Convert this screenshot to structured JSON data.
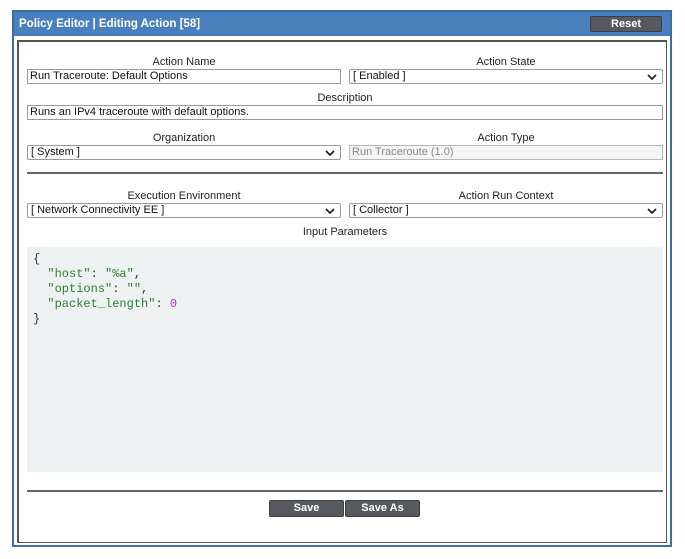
{
  "titlebar": {
    "title": "Policy Editor | Editing Action [58]",
    "reset_label": "Reset"
  },
  "form": {
    "action_name": {
      "label": "Action Name",
      "value": "Run Traceroute: Default Options"
    },
    "action_state": {
      "label": "Action State",
      "value": "[ Enabled ]"
    },
    "description": {
      "label": "Description",
      "value": "Runs an IPv4 traceroute with default options."
    },
    "organization": {
      "label": "Organization",
      "value": "[ System ]"
    },
    "action_type": {
      "label": "Action Type",
      "value": "Run Traceroute (1.0)"
    },
    "execution_environment": {
      "label": "Execution Environment",
      "value": "[ Network Connectivity EE ]"
    },
    "action_run_context": {
      "label": "Action Run Context",
      "value": "[ Collector ]"
    },
    "input_parameters": {
      "label": "Input Parameters",
      "open_brace": "{",
      "close_brace": "}",
      "entries": [
        {
          "key": "\"host\"",
          "value": "\"%a\"",
          "trail": ","
        },
        {
          "key": "\"options\"",
          "value": "\"\"",
          "trail": ","
        },
        {
          "key": "\"packet_length\"",
          "value": "0",
          "trail": ""
        }
      ]
    }
  },
  "footer": {
    "save_label": "Save",
    "save_as_label": "Save As"
  }
}
